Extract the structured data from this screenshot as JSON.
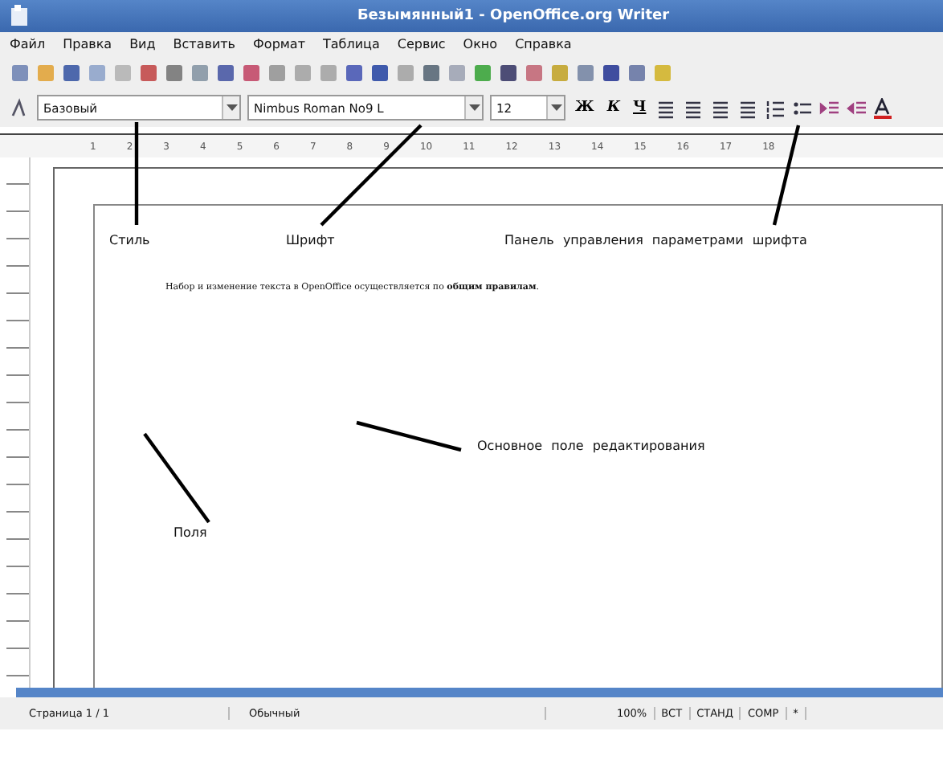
{
  "window": {
    "title": "Безымянный1 - OpenOffice.org Writer"
  },
  "menu": [
    "Файл",
    "Правка",
    "Вид",
    "Вставить",
    "Формат",
    "Таблица",
    "Сервис",
    "Окно",
    "Справка"
  ],
  "formatting": {
    "style": "Базовый",
    "font": "Nimbus Roman No9 L",
    "size": "12",
    "buttons": [
      "Ж",
      "К",
      "Ч"
    ]
  },
  "ruler": [
    "1",
    "2",
    "3",
    "4",
    "5",
    "6",
    "7",
    "8",
    "9",
    "10",
    "11",
    "12",
    "13",
    "14",
    "15",
    "16",
    "17",
    "18"
  ],
  "document": {
    "text": "Набор и изменение текста в OpenOffice осуществляется по **общим правилам**."
  },
  "annotations": [
    "Стиль",
    "Шрифт",
    "Панель управления параметрами шрифта",
    "Основное поле редактирования",
    "Поля"
  ],
  "status_bar": [
    "Страница 1 / 1",
    "Обычный",
    "100%",
    "ВСТ",
    "СТАНД",
    "СОМР",
    "*"
  ]
}
